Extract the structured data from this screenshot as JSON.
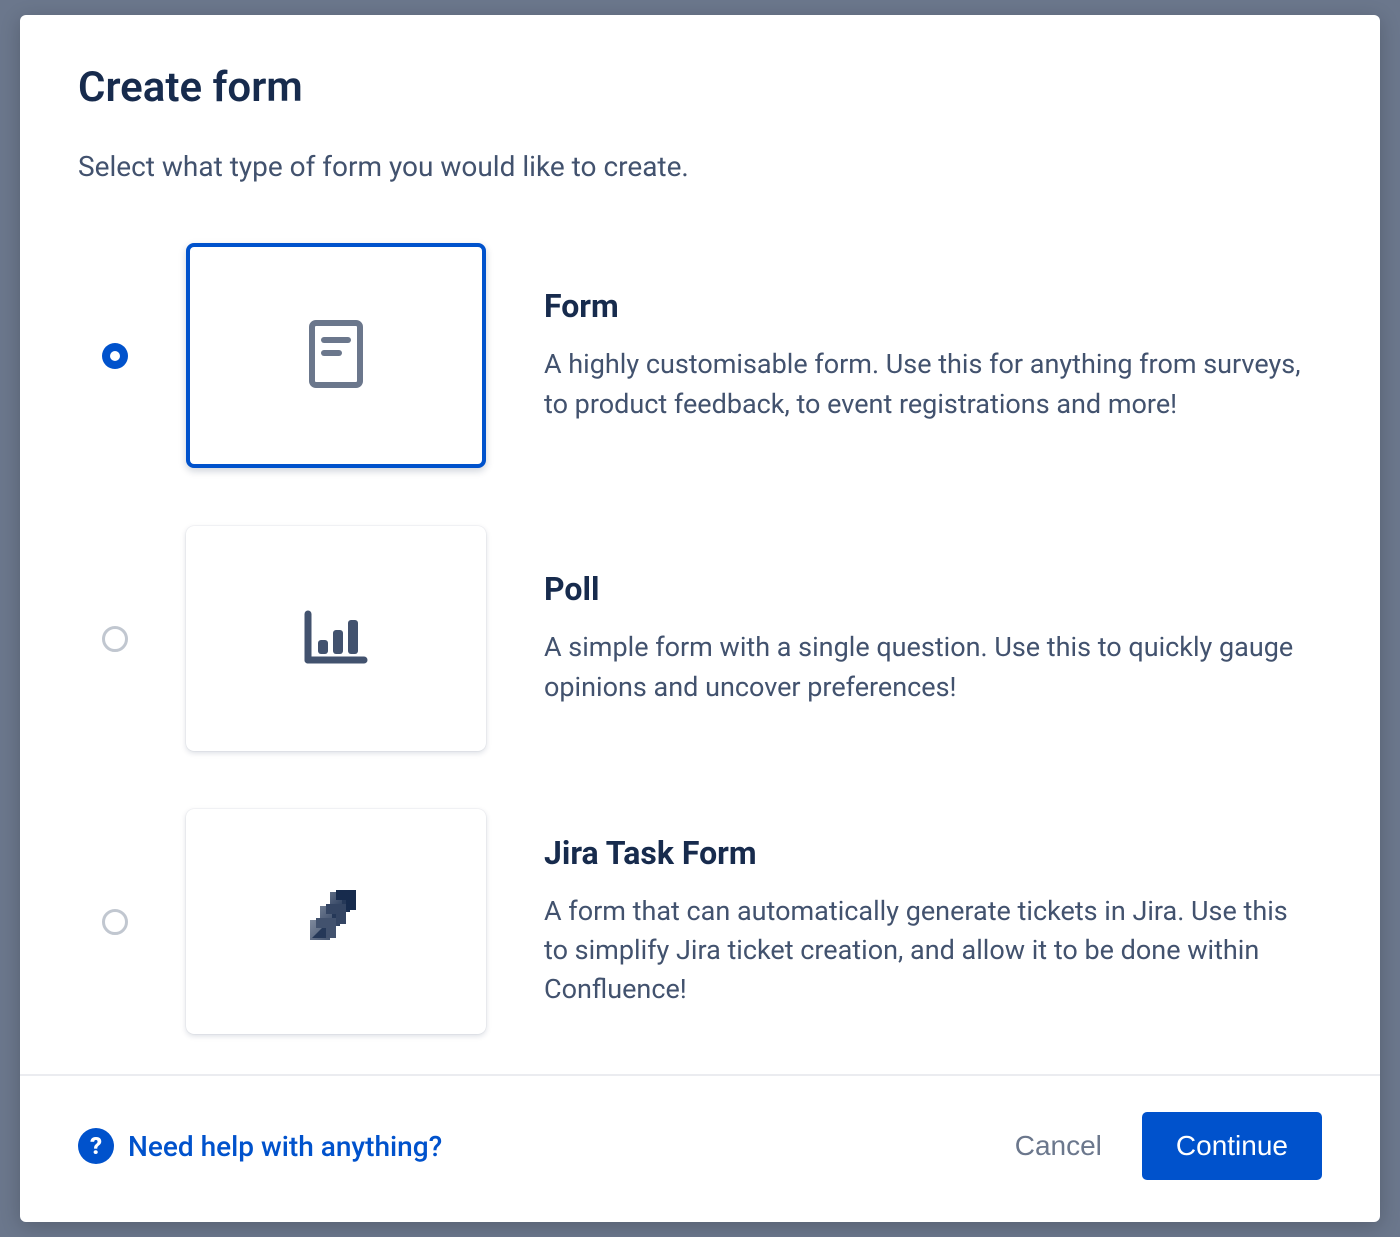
{
  "modal": {
    "title": "Create form",
    "subtitle": "Select what type of form you would like to create."
  },
  "options": [
    {
      "id": "form",
      "title": "Form",
      "description": "A highly customisable form. Use this for anything from surveys, to product feedback, to event registrations and more!",
      "selected": true,
      "icon": "form-icon"
    },
    {
      "id": "poll",
      "title": "Poll",
      "description": "A simple form with a single question. Use this to quickly gauge opinions and uncover preferences!",
      "selected": false,
      "icon": "poll-icon"
    },
    {
      "id": "jira",
      "title": "Jira Task Form",
      "description": "A form that can automatically generate tickets in Jira. Use this to simplify Jira ticket creation, and allow it to be done within Confluence!",
      "selected": false,
      "icon": "jira-icon"
    }
  ],
  "footer": {
    "help_label": "Need help with anything?",
    "cancel_label": "Cancel",
    "continue_label": "Continue"
  }
}
